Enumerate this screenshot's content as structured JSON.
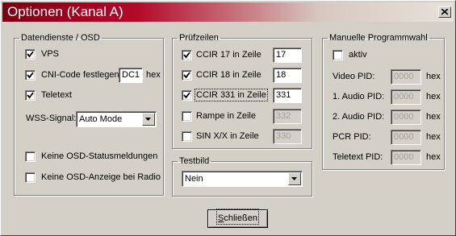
{
  "window": {
    "title": "Optionen (Kanal A)"
  },
  "datendienste": {
    "legend": "Datendienste / OSD",
    "vps": {
      "label": "VPS",
      "checked": true
    },
    "cni": {
      "label": "CNI-Code festlegen:",
      "checked": true,
      "value": "DC1",
      "unit": "hex"
    },
    "teletext": {
      "label": "Teletext",
      "checked": true
    },
    "wss": {
      "label": "WSS-Signal:",
      "value": "Auto Mode"
    },
    "keine_status": {
      "label": "Keine OSD-Statusmeldungen",
      "checked": false
    },
    "keine_radio": {
      "label": "Keine OSD-Anzeige bei Radio",
      "checked": false
    }
  },
  "pruefzeilen": {
    "legend": "Prüfzeilen",
    "rows": [
      {
        "label": "CCIR 17 in Zeile",
        "checked": true,
        "value": "17",
        "enabled": true
      },
      {
        "label": "CCIR 18 in Zeile",
        "checked": true,
        "value": "18",
        "enabled": true
      },
      {
        "label": "CCIR 331 in Zeile",
        "checked": true,
        "value": "331",
        "enabled": true
      },
      {
        "label": "Rampe in Zeile",
        "checked": false,
        "value": "332",
        "enabled": false
      },
      {
        "label": "SIN X/X in Zeile",
        "checked": false,
        "value": "330",
        "enabled": false
      }
    ]
  },
  "testbild": {
    "legend": "Testbild",
    "value": "Nein"
  },
  "manuell": {
    "legend": "Manuelle Programmwahl",
    "aktiv": {
      "label": "aktiv",
      "checked": false
    },
    "fields": [
      {
        "label": "Video PID:",
        "value": "0000",
        "unit": "hex"
      },
      {
        "label": "1. Audio PID:",
        "value": "0000",
        "unit": "hex"
      },
      {
        "label": "2. Audio PID:",
        "value": "0000",
        "unit": "hex"
      },
      {
        "label": "PCR PID:",
        "value": "0000",
        "unit": "hex"
      },
      {
        "label": "Teletext PID:",
        "value": "0000",
        "unit": "hex"
      }
    ]
  },
  "close_button": {
    "accel": "S",
    "rest": "chließen"
  }
}
